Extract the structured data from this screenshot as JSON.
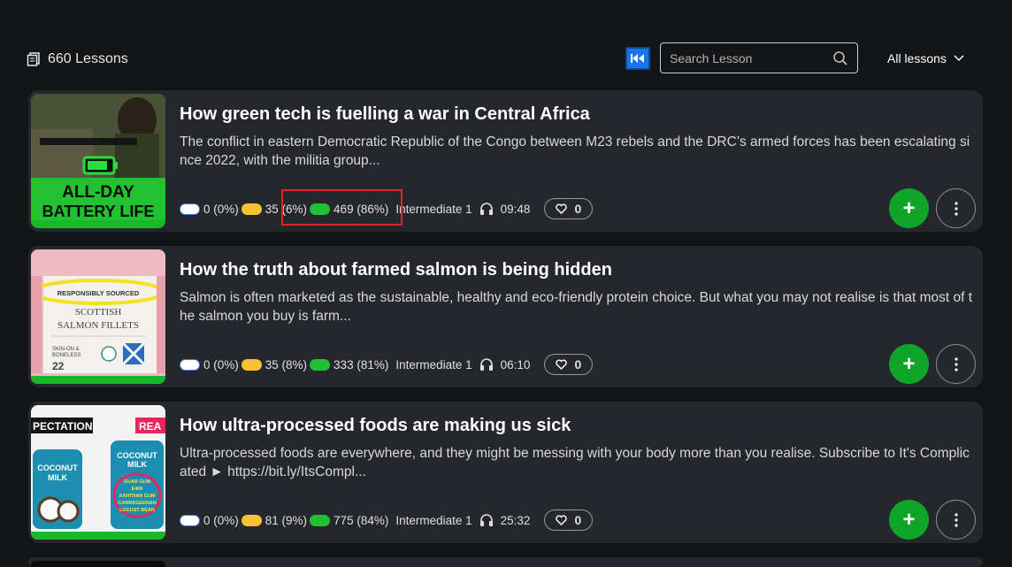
{
  "header": {
    "lesson_count": "660 Lessons",
    "search_placeholder": "Search Lesson",
    "filter_label": "All lessons"
  },
  "lessons": [
    {
      "title": "How green tech is fuelling a war in Central Africa",
      "description": "The conflict in eastern Democratic Republic of the Congo between M23 rebels and the DRC’s armed forces has been escalating since 2022, with the militia group...",
      "unknown": "0 (0%)",
      "learning": "35 (6%)",
      "known": "469 (86%)",
      "level": "Intermediate 1",
      "duration": "09:48",
      "likes": "0",
      "thumb_text": "ALL-DAY BATTERY LIFE"
    },
    {
      "title": "How the truth about farmed salmon is being hidden",
      "description": "Salmon is often marketed as the sustainable, healthy and eco-friendly protein choice. But what you may not realise is that most of the salmon you buy is farm...",
      "unknown": "0 (0%)",
      "learning": "35 (8%)",
      "known": "333 (81%)",
      "level": "Intermediate 1",
      "duration": "06:10",
      "likes": "0",
      "thumb_text": "RESPONSIBLY SOURCED SCOTTISH SALMON FILLETS"
    },
    {
      "title": "How ultra-processed foods are making us sick",
      "description": "Ultra-processed foods are everywhere, and they might be messing with your body more than you realise. Subscribe to It's Complicated ► https://bit.ly/ItsCompl...",
      "unknown": "0 (0%)",
      "learning": "81 (9%)",
      "known": "775 (84%)",
      "level": "Intermediate 1",
      "duration": "25:32",
      "likes": "0",
      "thumb_text": "COCONUT MILK"
    }
  ]
}
